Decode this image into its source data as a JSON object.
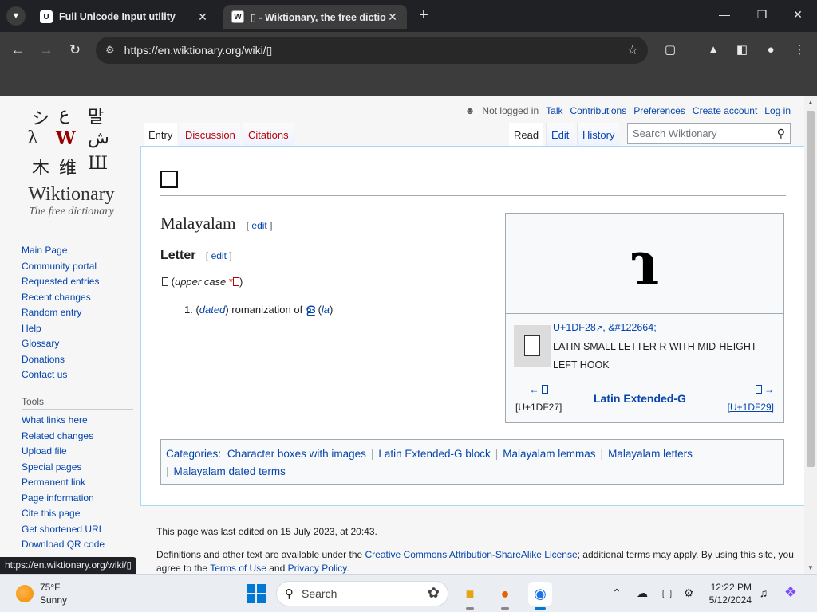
{
  "browser": {
    "tabs": [
      {
        "title": "Full Unicode Input utility",
        "favicon": "U"
      },
      {
        "title": "▯ - Wiktionary, the free dictionary",
        "favicon": "W"
      }
    ],
    "url": "https://en.wiktionary.org/wiki/▯",
    "status_url": "https://en.wiktionary.org/wiki/▯"
  },
  "logo": {
    "name": "Wiktionary",
    "tagline": "The free dictionary",
    "glyphs": [
      "シ",
      "ع",
      "말",
      "λ",
      "W",
      "ش",
      "木",
      "维",
      "Ш"
    ]
  },
  "sidebar": {
    "nav": [
      "Main Page",
      "Community portal",
      "Requested entries",
      "Recent changes",
      "Random entry",
      "Help",
      "Glossary",
      "Donations",
      "Contact us"
    ],
    "tools_heading": "Tools",
    "tools": [
      "What links here",
      "Related changes",
      "Upload file",
      "Special pages",
      "Permanent link",
      "Page information",
      "Cite this page",
      "Get shortened URL",
      "Download QR code"
    ]
  },
  "personal": {
    "not_logged_in": "Not logged in",
    "links": [
      "Talk",
      "Contributions",
      "Preferences",
      "Create account",
      "Log in"
    ]
  },
  "content_tabs": {
    "left": [
      "Entry",
      "Discussion",
      "Citations"
    ],
    "right": [
      "Read",
      "Edit",
      "History"
    ]
  },
  "search": {
    "placeholder": "Search Wiktionary"
  },
  "article": {
    "section": "Malayalam",
    "edit": "edit",
    "subsection": "Letter",
    "headword_paren_open": "(",
    "upper_case": "upper case",
    "asterisk": "*",
    "paren_close": ")",
    "def_number": "1.",
    "def_label": "dated",
    "def_text": "romanization of",
    "def_target": "ള",
    "def_translit": "ḷa"
  },
  "charbox": {
    "glyph": "ɿ",
    "code": "U+1DF28",
    "entity": "&#122664;",
    "name": "LATIN SMALL LETTER R WITH MID-HEIGHT LEFT HOOK",
    "prev_arrow": "←",
    "prev_code": "[U+1DF27]",
    "next_arrow": "→",
    "next_code": "[U+1DF29]",
    "block": "Latin Extended-G"
  },
  "categories": {
    "label": "Categories",
    "items": [
      "Character boxes with images",
      "Latin Extended-G block",
      "Malayalam lemmas",
      "Malayalam letters",
      "Malayalam dated terms"
    ]
  },
  "footer": {
    "last_edited": "This page was last edited on 15 July 2023, at 20:43.",
    "license_prefix": "Definitions and other text are available under the",
    "license_link": "Creative Commons Attribution-ShareAlike License",
    "license_mid": "; additional terms may apply. By using this site, you agree to the",
    "terms_link": "Terms of Use",
    "and": "and",
    "privacy_link": "Privacy Policy."
  },
  "taskbar": {
    "temp": "75°F",
    "condition": "Sunny",
    "search_label": "Search",
    "time": "12:22 PM",
    "date": "5/12/2024"
  }
}
